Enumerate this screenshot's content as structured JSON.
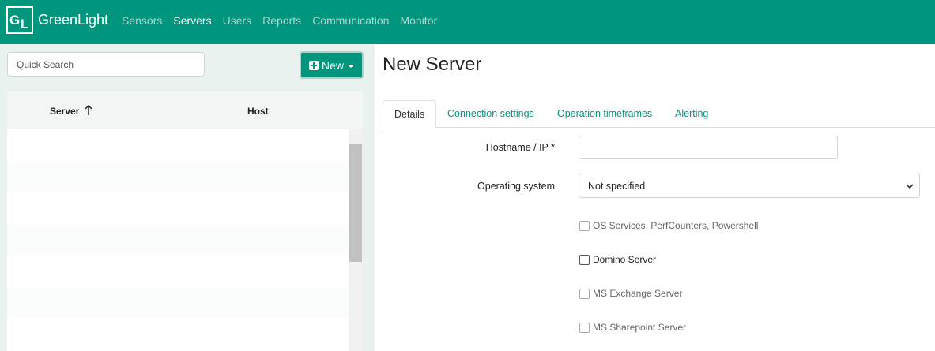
{
  "app": {
    "logo_letters_1": "G",
    "logo_letters_2": "L",
    "brand": "GreenLight"
  },
  "nav": {
    "items": [
      "Sensors",
      "Servers",
      "Users",
      "Reports",
      "Communication",
      "Monitor"
    ],
    "active": "Servers"
  },
  "left": {
    "search_placeholder": "Quick Search",
    "new_button_label": "New",
    "grid": {
      "columns": [
        "Server",
        "Host"
      ],
      "sort": "ascending",
      "rows": []
    }
  },
  "main": {
    "title": "New Server",
    "tabs": [
      "Details",
      "Connection settings",
      "Operation timeframes",
      "Alerting"
    ],
    "active_tab": "Details",
    "form": {
      "hostname_label": "Hostname / IP *",
      "hostname_value": "",
      "os_label": "Operating system",
      "os_value": "Not specified",
      "checkboxes": [
        {
          "label": "OS Services, PerfCounters, Powershell",
          "checked": false,
          "enabled": false
        },
        {
          "label": "Domino Server",
          "checked": false,
          "enabled": true
        },
        {
          "label": "MS Exchange Server",
          "checked": false,
          "enabled": false
        },
        {
          "label": "MS Sharepoint Server",
          "checked": false,
          "enabled": false
        }
      ]
    }
  },
  "colors": {
    "brand": "#00967d",
    "nav_inactive": "#a7d9d0",
    "left_pane_bg": "#e9f2ef"
  }
}
